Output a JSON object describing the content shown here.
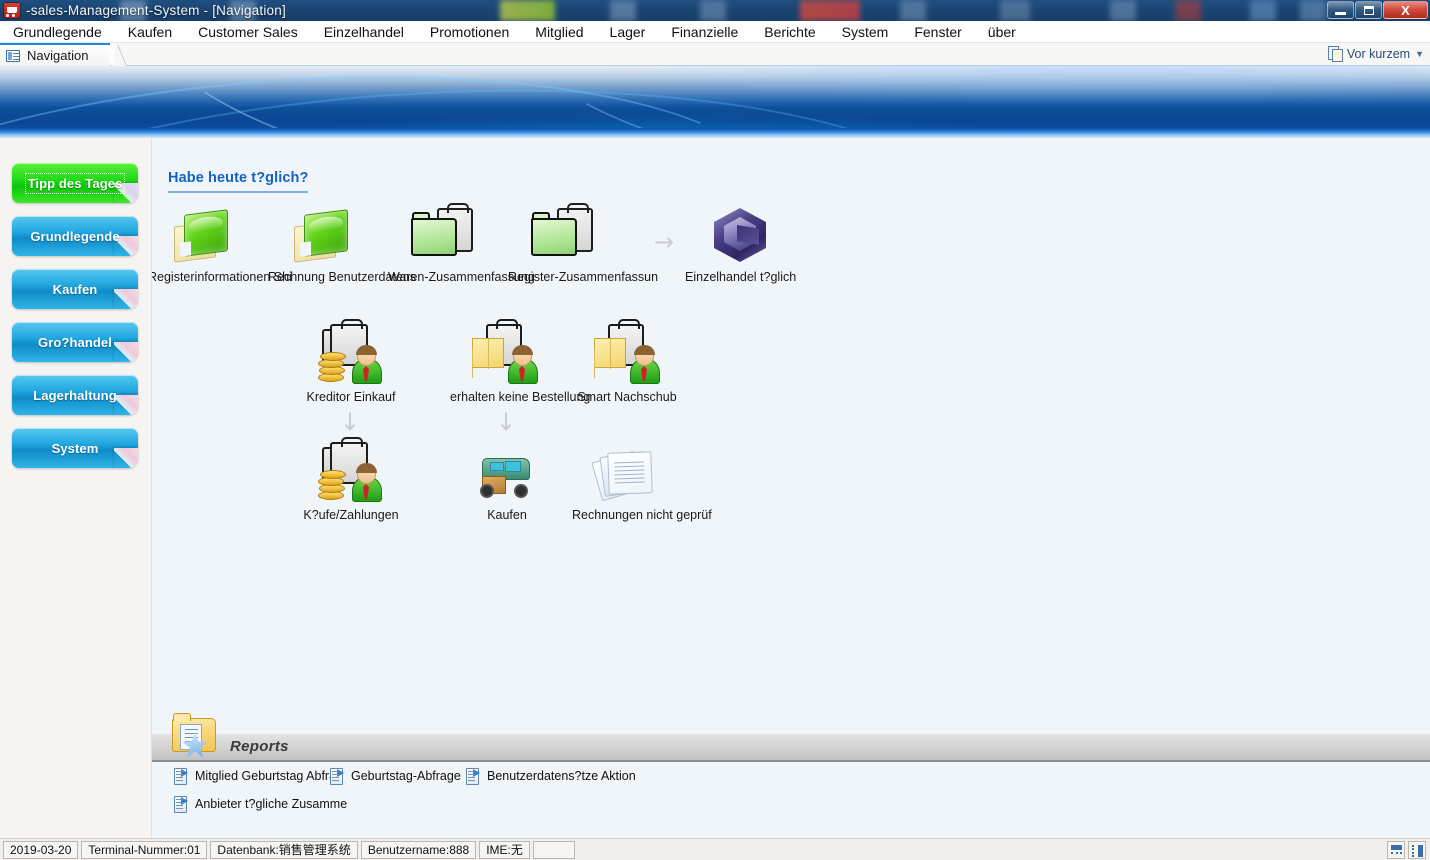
{
  "window": {
    "title": "-sales-Management-System - [Navigation]",
    "app_icon": "shopping-cart-icon",
    "minimize_label": "Minimize",
    "restore_label": "Restore",
    "close_label": "X"
  },
  "menubar": {
    "items": [
      "Grundlegende",
      "Kaufen",
      "Customer Sales",
      "Einzelhandel",
      "Promotionen",
      "Mitglied",
      "Lager",
      "Finanzielle",
      "Berichte",
      "System",
      "Fenster",
      "über"
    ]
  },
  "tabstrip": {
    "active_tab": "Navigation",
    "recent_label": "Vor kurzem",
    "recent_caret": "▼"
  },
  "sidebar": {
    "items": [
      {
        "label": "Tipp des Tages",
        "color": "#19c810",
        "selected": true
      },
      {
        "label": "Grundlegende",
        "color": "#18a6de",
        "selected": false
      },
      {
        "label": "Kaufen",
        "color": "#18a6de",
        "selected": false
      },
      {
        "label": "Gro?handel",
        "color": "#18a6de",
        "selected": false
      },
      {
        "label": "Lagerhaltung",
        "color": "#18a6de",
        "selected": false
      },
      {
        "label": "System",
        "color": "#18a6de",
        "selected": false
      }
    ]
  },
  "content": {
    "section_title": "Habe heute t?glich?",
    "row1": [
      {
        "label": "Registerinformationen Shi",
        "icon": "green-book-icon"
      },
      {
        "label": "Rechnung Benutzerdatens",
        "icon": "green-book-icon"
      },
      {
        "label": "Waren-Zusammenfassung",
        "icon": "folder-clipboard-icon"
      },
      {
        "label": "Register-Zusammenfassun",
        "icon": "folder-clipboard-icon"
      }
    ],
    "row1_arrow": "→",
    "row1_end": {
      "label": "Einzelhandel t?glich",
      "icon": "hex-cube-icon"
    },
    "row2": [
      {
        "label": "Kreditor Einkauf",
        "icon": "person-coins-clipboard-icon"
      },
      {
        "label": "erhalten keine Bestellung",
        "icon": "person-box-clipboard-icon"
      },
      {
        "label": "Smart Nachschub",
        "icon": "person-box-clipboard-icon"
      }
    ],
    "row_arrows": "↓",
    "row3": [
      {
        "label": "K?ufe/Zahlungen",
        "icon": "person-coins-clipboard-icon"
      },
      {
        "label": "Kaufen",
        "icon": "delivery-truck-icon"
      },
      {
        "label": "Rechnungen nicht geprüf",
        "icon": "stacked-papers-icon"
      }
    ]
  },
  "reports": {
    "title": "Reports",
    "icon": "folder-star-icon",
    "links": [
      "Mitglied Geburtstag Abfrag",
      "Geburtstag-Abfrage",
      "Benutzerdatens?tze Aktion",
      "Anbieter t?gliche Zusamme"
    ]
  },
  "statusbar": {
    "date": "2019-03-20",
    "terminal": "Terminal-Nummer:01",
    "database": "Datenbank:销售管理系统",
    "username": "Benutzername:888",
    "ime": "IME:无",
    "blank": "",
    "icons": [
      "layout-horizontal-icon",
      "layout-vertical-icon"
    ]
  },
  "colors": {
    "accent_blue": "#1461c4",
    "banner_blue": "#0e4f9c",
    "sidebar_bg": "#f5f4f2",
    "content_bg": "#f0f5fa",
    "tab_accent": "#1d8ae0"
  }
}
